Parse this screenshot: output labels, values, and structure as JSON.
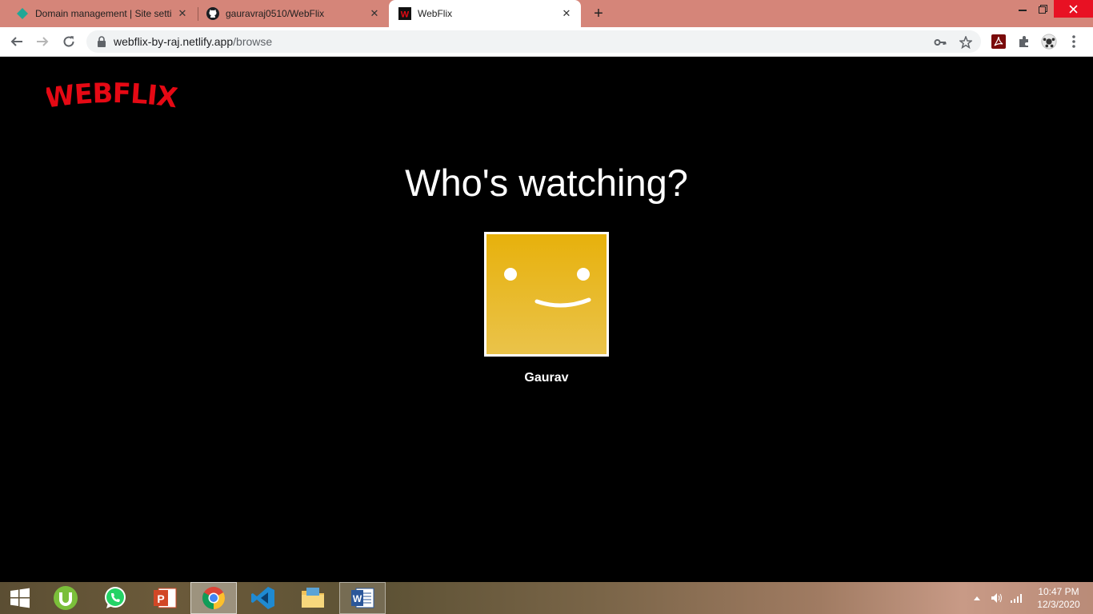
{
  "browser": {
    "tabs": [
      {
        "title": "Domain management | Site settin",
        "icon": "netlify-diamond-icon",
        "active": false
      },
      {
        "title": "gauravraj0510/WebFlix",
        "icon": "github-icon",
        "active": false
      },
      {
        "title": "WebFlix",
        "icon": "webflix-favicon",
        "active": true
      }
    ],
    "url_host": "webflix-by-raj.netlify.app",
    "url_path": "/browse"
  },
  "page": {
    "logo_text": "WEBFLIX",
    "heading": "Who's watching?",
    "profiles": [
      {
        "name": "Gaurav",
        "avatar": "smiley-face-icon",
        "color": "#e7b10c"
      }
    ]
  },
  "taskbar": {
    "apps": [
      "windows-start-icon",
      "utorrent-icon",
      "whatsapp-icon",
      "powerpoint-icon",
      "chrome-icon",
      "vscode-icon",
      "file-explorer-icon",
      "word-icon"
    ],
    "time": "10:47 PM",
    "date": "12/3/2020"
  },
  "colors": {
    "tabbar": "#d58579",
    "brand_red": "#e50914",
    "avatar_yellow": "#e7b10c"
  }
}
